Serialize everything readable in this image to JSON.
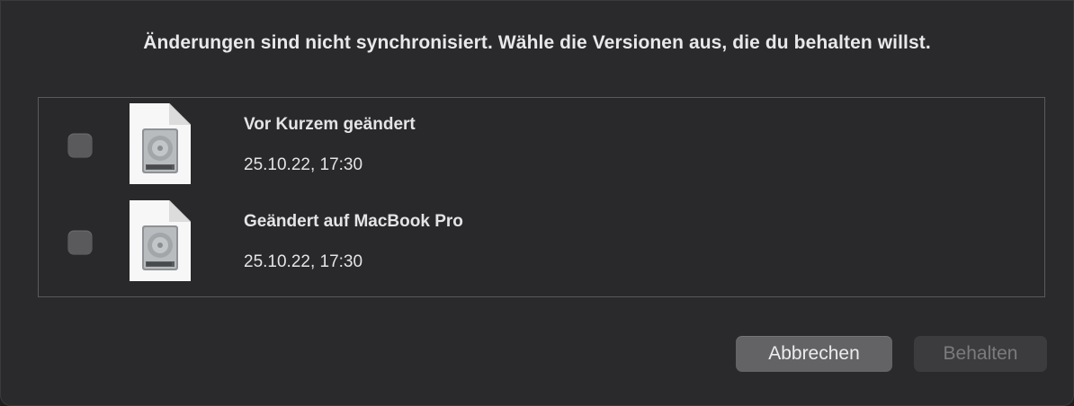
{
  "dialog": {
    "title": "Änderungen sind nicht synchronisiert. Wähle die Versionen aus, die du behalten willst."
  },
  "versions": [
    {
      "name": "Vor Kurzem geändert",
      "date": "25.10.22, 17:30",
      "checked": false,
      "icon": "document-disk-image-icon"
    },
    {
      "name": "Geändert auf MacBook Pro",
      "date": "25.10.22, 17:30",
      "checked": false,
      "icon": "document-disk-image-icon"
    }
  ],
  "buttons": {
    "cancel_label": "Abbrechen",
    "keep_label": "Behalten",
    "keep_enabled": false
  },
  "colors": {
    "dialog_background": "#2a2a2c",
    "text": "#e4e4e6",
    "cancel_button": "#636366",
    "disabled_button": "#3c3c3e",
    "disabled_text": "#7b7b7e"
  }
}
